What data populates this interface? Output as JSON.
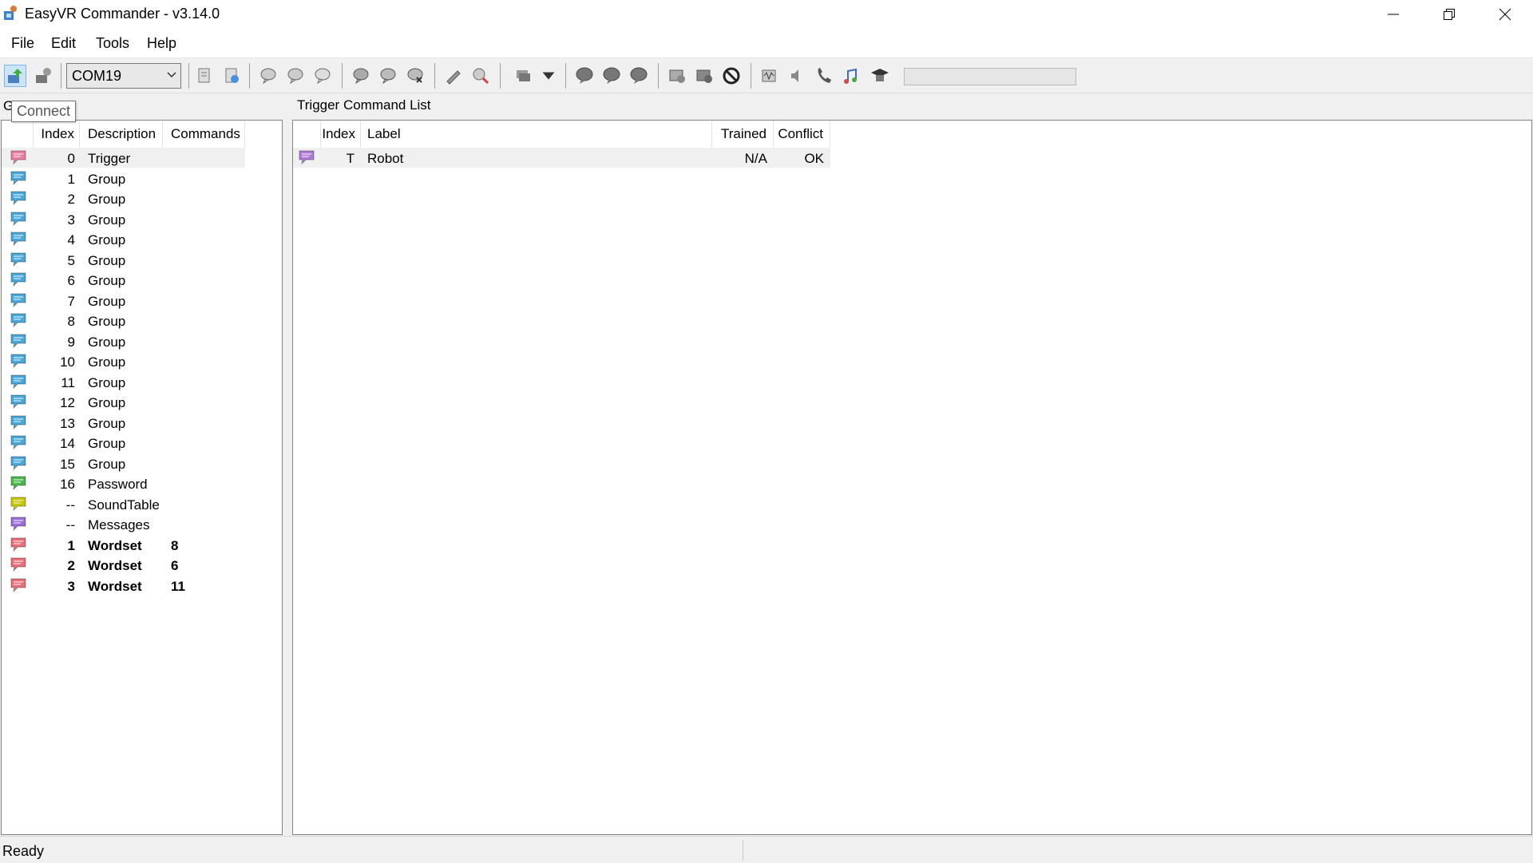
{
  "window": {
    "title": "EasyVR Commander - v3.14.0",
    "controls": [
      "minimize",
      "restore",
      "close"
    ]
  },
  "menu": [
    "File",
    "Edit",
    "Tools",
    "Help"
  ],
  "toolbar": {
    "port": "COM19",
    "progress": 0,
    "tooltip": "Connect"
  },
  "left_panel": {
    "label": "G",
    "columns": [
      "Index",
      "Description",
      "Commands"
    ],
    "rows": [
      {
        "index": "0",
        "description": "Trigger",
        "commands": "",
        "bold": false,
        "color": "#e87fa0"
      },
      {
        "index": "1",
        "description": "Group",
        "commands": "",
        "bold": false,
        "color": "#4aa8d8"
      },
      {
        "index": "2",
        "description": "Group",
        "commands": "",
        "bold": false,
        "color": "#4aa8d8"
      },
      {
        "index": "3",
        "description": "Group",
        "commands": "",
        "bold": false,
        "color": "#4aa8d8"
      },
      {
        "index": "4",
        "description": "Group",
        "commands": "",
        "bold": false,
        "color": "#4aa8d8"
      },
      {
        "index": "5",
        "description": "Group",
        "commands": "",
        "bold": false,
        "color": "#4aa8d8"
      },
      {
        "index": "6",
        "description": "Group",
        "commands": "",
        "bold": false,
        "color": "#4aa8d8"
      },
      {
        "index": "7",
        "description": "Group",
        "commands": "",
        "bold": false,
        "color": "#4aa8d8"
      },
      {
        "index": "8",
        "description": "Group",
        "commands": "",
        "bold": false,
        "color": "#4aa8d8"
      },
      {
        "index": "9",
        "description": "Group",
        "commands": "",
        "bold": false,
        "color": "#4aa8d8"
      },
      {
        "index": "10",
        "description": "Group",
        "commands": "",
        "bold": false,
        "color": "#4aa8d8"
      },
      {
        "index": "11",
        "description": "Group",
        "commands": "",
        "bold": false,
        "color": "#4aa8d8"
      },
      {
        "index": "12",
        "description": "Group",
        "commands": "",
        "bold": false,
        "color": "#4aa8d8"
      },
      {
        "index": "13",
        "description": "Group",
        "commands": "",
        "bold": false,
        "color": "#4aa8d8"
      },
      {
        "index": "14",
        "description": "Group",
        "commands": "",
        "bold": false,
        "color": "#4aa8d8"
      },
      {
        "index": "15",
        "description": "Group",
        "commands": "",
        "bold": false,
        "color": "#4aa8d8"
      },
      {
        "index": "16",
        "description": "Password",
        "commands": "",
        "bold": false,
        "color": "#4cb84c"
      },
      {
        "index": "--",
        "description": "SoundTable",
        "commands": "",
        "bold": false,
        "color": "#c8c800"
      },
      {
        "index": "--",
        "description": "Messages",
        "commands": "",
        "bold": false,
        "color": "#9a6ed6"
      },
      {
        "index": "1",
        "description": "Wordset",
        "commands": "8",
        "bold": true,
        "color": "#e8707a"
      },
      {
        "index": "2",
        "description": "Wordset",
        "commands": "6",
        "bold": true,
        "color": "#e8707a"
      },
      {
        "index": "3",
        "description": "Wordset",
        "commands": "11",
        "bold": true,
        "color": "#e8707a"
      }
    ]
  },
  "right_panel": {
    "label": "Trigger Command List",
    "columns": [
      "Index",
      "Label",
      "Trained",
      "Conflict"
    ],
    "rows": [
      {
        "index": "T",
        "label": "Robot",
        "trained": "N/A",
        "conflict": "OK",
        "color": "#b07ad8"
      }
    ]
  },
  "status": {
    "text": "Ready"
  }
}
